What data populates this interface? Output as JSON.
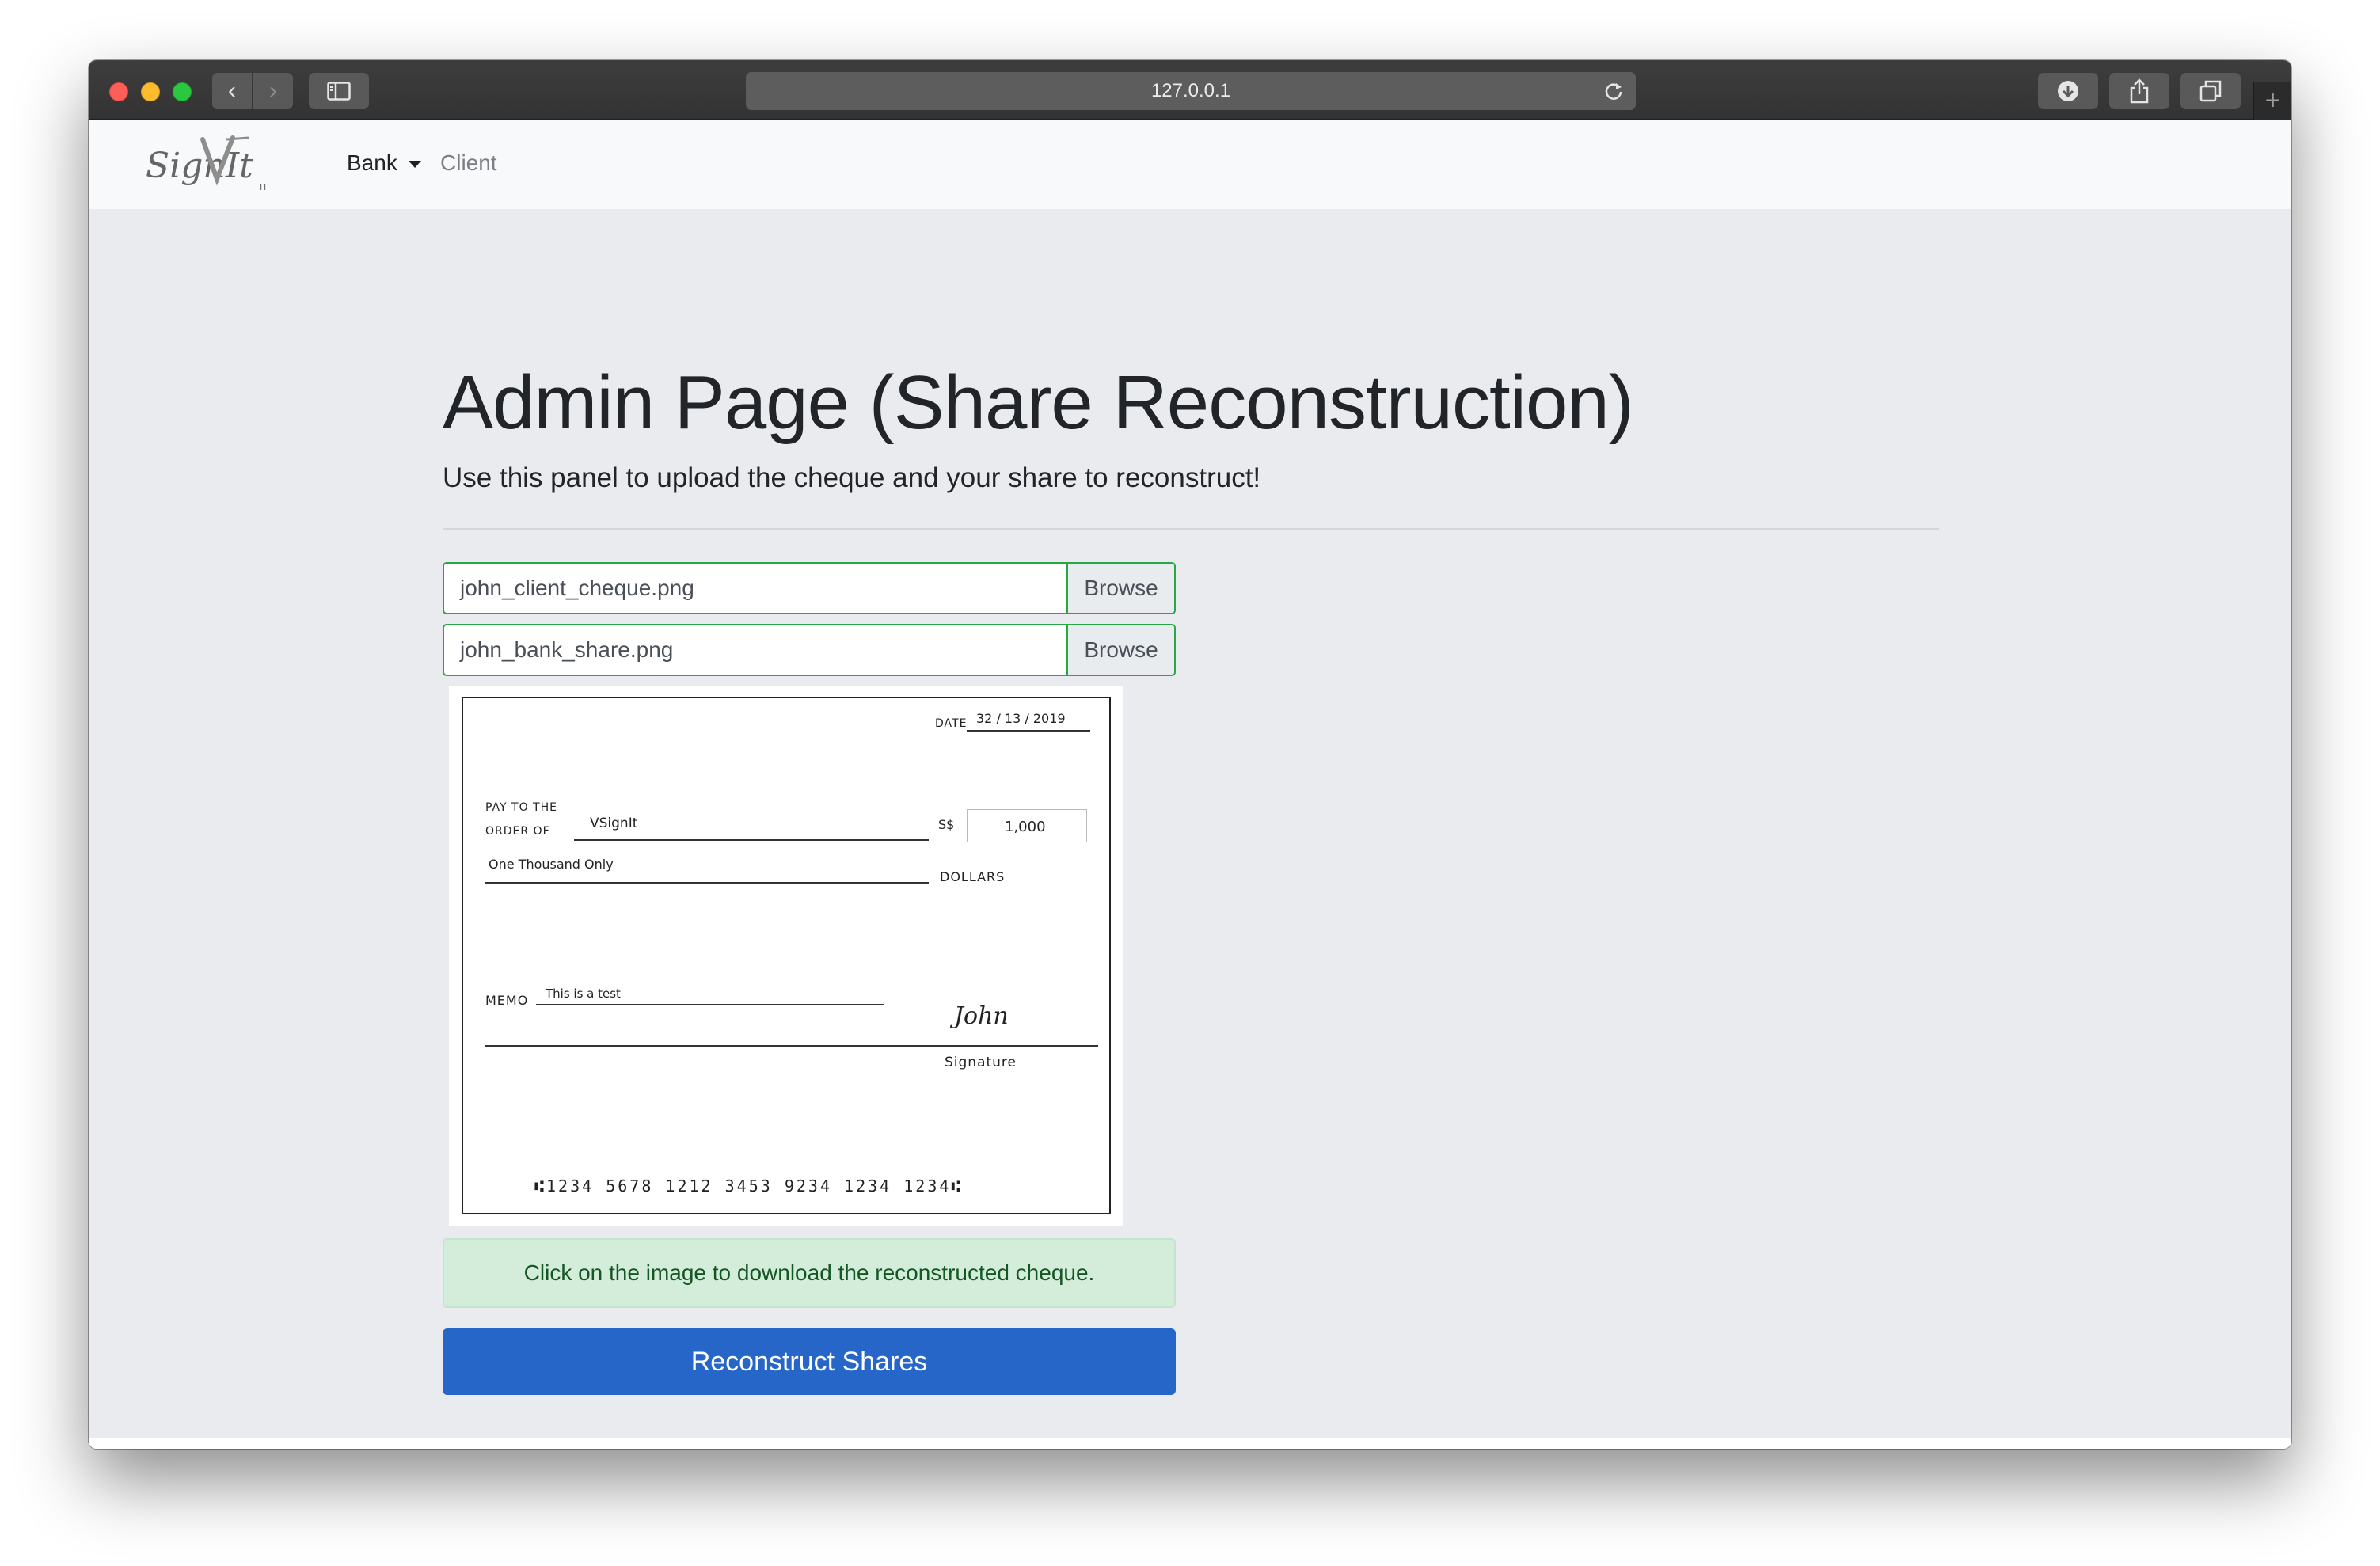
{
  "browser": {
    "url": "127.0.0.1",
    "back_glyph": "‹",
    "forward_glyph": "›",
    "new_tab_glyph": "+"
  },
  "navbar": {
    "logo_text": "SignIt",
    "logo_sub": "IT",
    "bank_label": "Bank",
    "client_label": "Client"
  },
  "main": {
    "title": "Admin Page (Share Reconstruction)",
    "lead": "Use this panel to upload the cheque and your share to reconstruct!",
    "file_inputs": [
      {
        "filename": "john_client_cheque.png",
        "browse_label": "Browse"
      },
      {
        "filename": "john_bank_share.png",
        "browse_label": "Browse"
      }
    ],
    "alert_text": "Click on the image to download the reconstructed cheque.",
    "reconstruct_button": "Reconstruct Shares"
  },
  "cheque": {
    "date_label": "DATE",
    "date_value": "32 / 13 / 2019",
    "pay_to_label_1": "PAY TO THE",
    "pay_to_label_2": "ORDER OF",
    "payee": "VSignIt",
    "currency": "S$",
    "amount": "1,000",
    "amount_words": "One Thousand Only",
    "dollars_label": "DOLLARS",
    "memo_label": "MEMO",
    "memo_value": "This is a test",
    "signature_text": "John",
    "signature_label": "Signature",
    "micr_line": "⑆1234  5678  1212  3453  9234  1234  1234⑆"
  },
  "colors": {
    "accent_primary": "#2666c8",
    "success_border": "#28a745",
    "alert_bg": "#d4edda",
    "alert_text": "#155724",
    "page_bg": "#e9ebee"
  },
  "icons": {
    "back": "chevron-left-icon",
    "forward": "chevron-right-icon",
    "sidebar": "sidebar-icon",
    "reload": "reload-icon",
    "download": "download-icon",
    "share": "share-icon",
    "tabs": "tabs-icon",
    "new_tab": "plus-icon",
    "dropdown": "caret-down-icon"
  }
}
